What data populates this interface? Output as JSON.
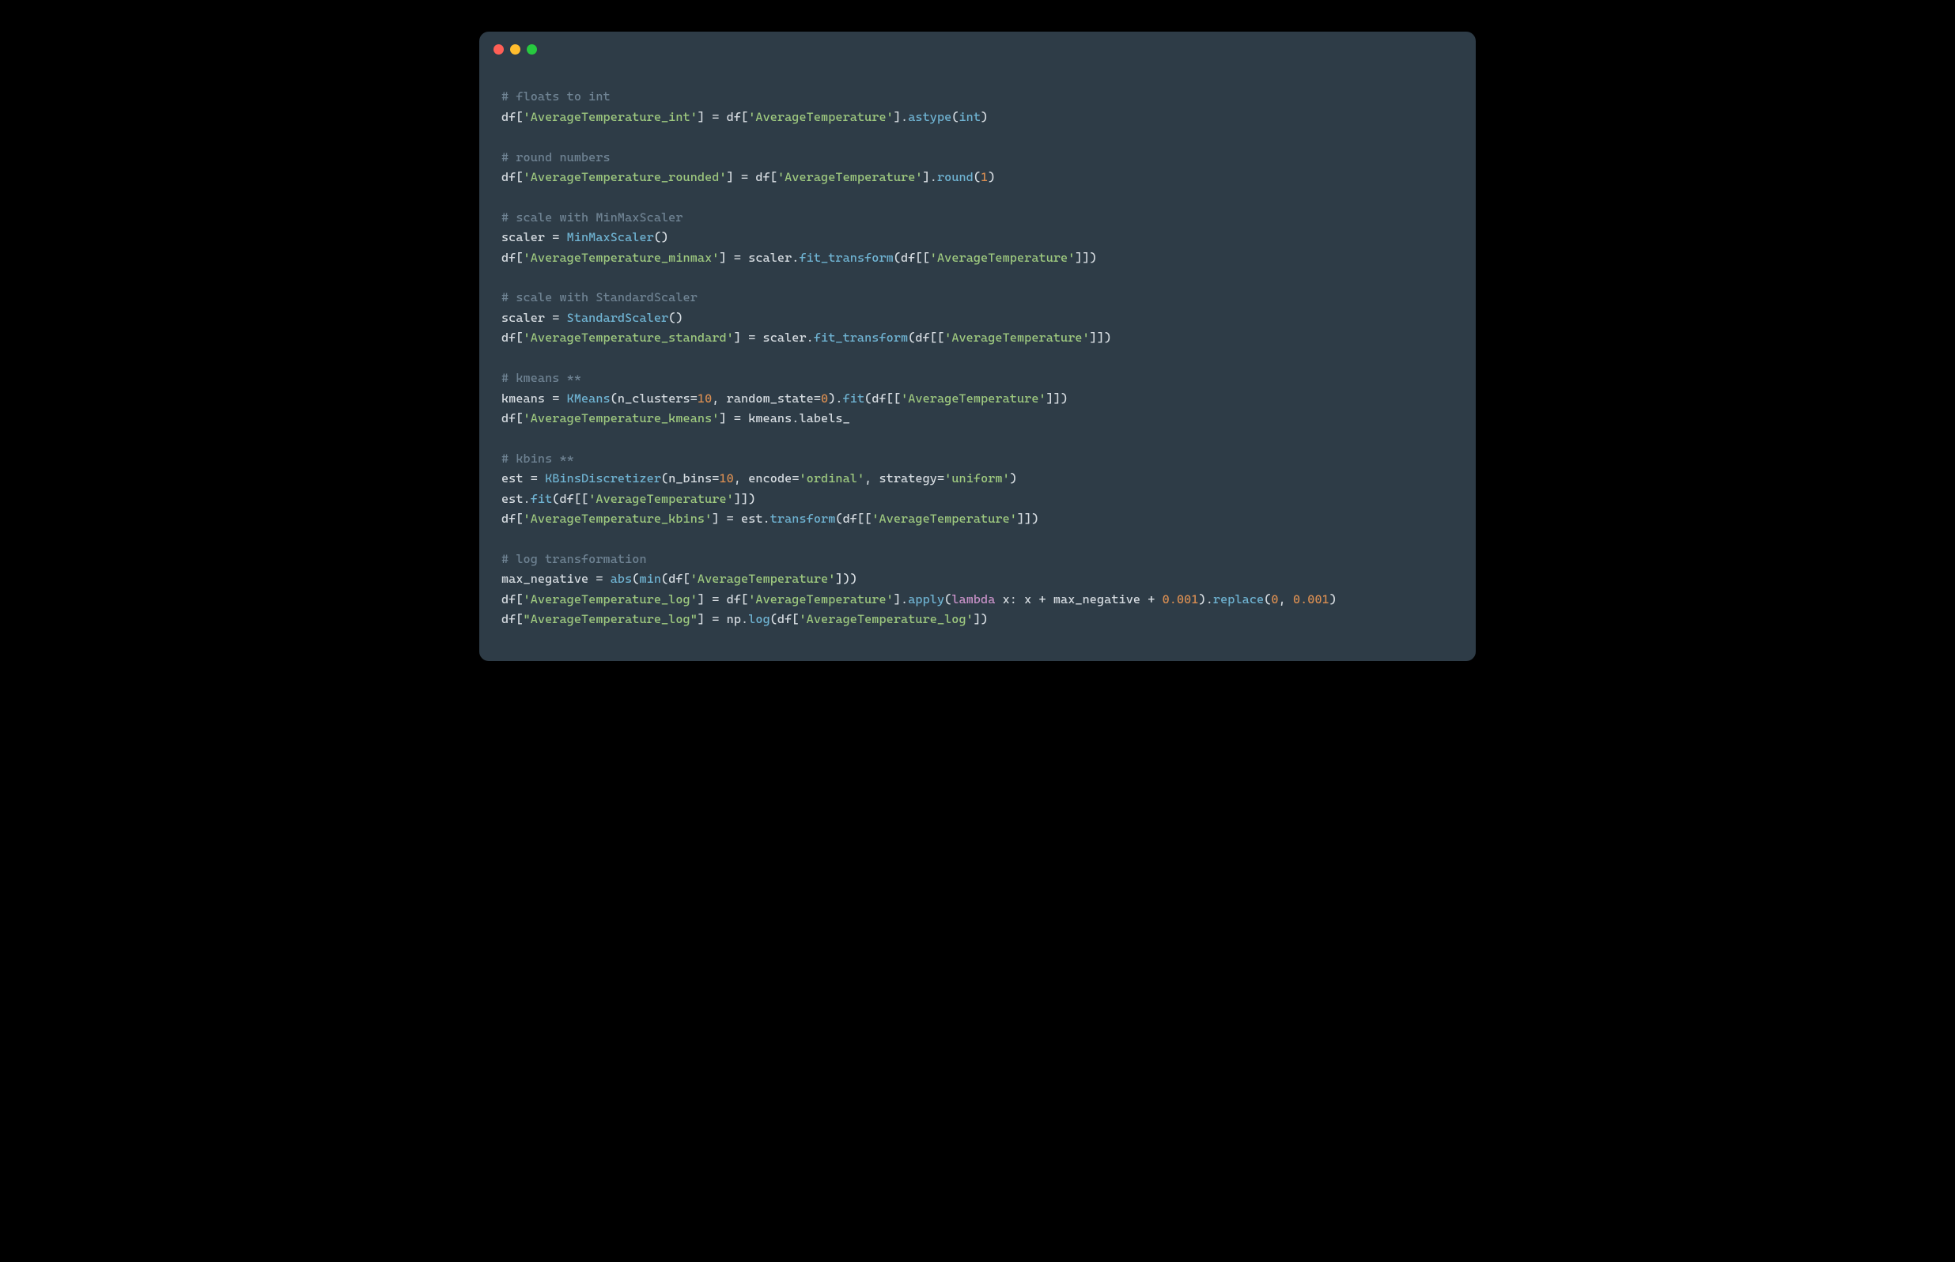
{
  "window": {
    "traffic_lights": [
      "red",
      "yellow",
      "green"
    ]
  },
  "code": {
    "blocks": [
      {
        "comment": "# floats to int",
        "lines": [
          [
            {
              "t": "id",
              "v": "df["
            },
            {
              "t": "str",
              "v": "'AverageTemperature_int'"
            },
            {
              "t": "id",
              "v": "] = df["
            },
            {
              "t": "str",
              "v": "'AverageTemperature'"
            },
            {
              "t": "id",
              "v": "]."
            },
            {
              "t": "fn",
              "v": "astype"
            },
            {
              "t": "id",
              "v": "("
            },
            {
              "t": "fn",
              "v": "int"
            },
            {
              "t": "id",
              "v": ")"
            }
          ]
        ]
      },
      {
        "comment": "# round numbers",
        "lines": [
          [
            {
              "t": "id",
              "v": "df["
            },
            {
              "t": "str",
              "v": "'AverageTemperature_rounded'"
            },
            {
              "t": "id",
              "v": "] = df["
            },
            {
              "t": "str",
              "v": "'AverageTemperature'"
            },
            {
              "t": "id",
              "v": "]."
            },
            {
              "t": "fn",
              "v": "round"
            },
            {
              "t": "id",
              "v": "("
            },
            {
              "t": "num",
              "v": "1"
            },
            {
              "t": "id",
              "v": ")"
            }
          ]
        ]
      },
      {
        "comment": "# scale with MinMaxScaler",
        "lines": [
          [
            {
              "t": "id",
              "v": "scaler = "
            },
            {
              "t": "fn",
              "v": "MinMaxScaler"
            },
            {
              "t": "id",
              "v": "()"
            }
          ],
          [
            {
              "t": "id",
              "v": "df["
            },
            {
              "t": "str",
              "v": "'AverageTemperature_minmax'"
            },
            {
              "t": "id",
              "v": "] = scaler."
            },
            {
              "t": "fn",
              "v": "fit_transform"
            },
            {
              "t": "id",
              "v": "(df[["
            },
            {
              "t": "str",
              "v": "'AverageTemperature'"
            },
            {
              "t": "id",
              "v": "]])"
            }
          ]
        ]
      },
      {
        "comment": "# scale with StandardScaler",
        "lines": [
          [
            {
              "t": "id",
              "v": "scaler = "
            },
            {
              "t": "fn",
              "v": "StandardScaler"
            },
            {
              "t": "id",
              "v": "()"
            }
          ],
          [
            {
              "t": "id",
              "v": "df["
            },
            {
              "t": "str",
              "v": "'AverageTemperature_standard'"
            },
            {
              "t": "id",
              "v": "] = scaler."
            },
            {
              "t": "fn",
              "v": "fit_transform"
            },
            {
              "t": "id",
              "v": "(df[["
            },
            {
              "t": "str",
              "v": "'AverageTemperature'"
            },
            {
              "t": "id",
              "v": "]])"
            }
          ]
        ]
      },
      {
        "comment": "# kmeans **",
        "lines": [
          [
            {
              "t": "id",
              "v": "kmeans = "
            },
            {
              "t": "fn",
              "v": "KMeans"
            },
            {
              "t": "id",
              "v": "(n_clusters="
            },
            {
              "t": "num",
              "v": "10"
            },
            {
              "t": "id",
              "v": ", random_state="
            },
            {
              "t": "num",
              "v": "0"
            },
            {
              "t": "id",
              "v": ")."
            },
            {
              "t": "fn",
              "v": "fit"
            },
            {
              "t": "id",
              "v": "(df[["
            },
            {
              "t": "str",
              "v": "'AverageTemperature'"
            },
            {
              "t": "id",
              "v": "]])"
            }
          ],
          [
            {
              "t": "id",
              "v": "df["
            },
            {
              "t": "str",
              "v": "'AverageTemperature_kmeans'"
            },
            {
              "t": "id",
              "v": "] = kmeans.labels_"
            }
          ]
        ]
      },
      {
        "comment": "# kbins **",
        "lines": [
          [
            {
              "t": "id",
              "v": "est = "
            },
            {
              "t": "fn",
              "v": "KBinsDiscretizer"
            },
            {
              "t": "id",
              "v": "(n_bins="
            },
            {
              "t": "num",
              "v": "10"
            },
            {
              "t": "id",
              "v": ", encode="
            },
            {
              "t": "str",
              "v": "'ordinal'"
            },
            {
              "t": "id",
              "v": ", strategy="
            },
            {
              "t": "str",
              "v": "'uniform'"
            },
            {
              "t": "id",
              "v": ")"
            }
          ],
          [
            {
              "t": "id",
              "v": "est."
            },
            {
              "t": "fn",
              "v": "fit"
            },
            {
              "t": "id",
              "v": "(df[["
            },
            {
              "t": "str",
              "v": "'AverageTemperature'"
            },
            {
              "t": "id",
              "v": "]])"
            }
          ],
          [
            {
              "t": "id",
              "v": "df["
            },
            {
              "t": "str",
              "v": "'AverageTemperature_kbins'"
            },
            {
              "t": "id",
              "v": "] = est."
            },
            {
              "t": "fn",
              "v": "transform"
            },
            {
              "t": "id",
              "v": "(df[["
            },
            {
              "t": "str",
              "v": "'AverageTemperature'"
            },
            {
              "t": "id",
              "v": "]])"
            }
          ]
        ]
      },
      {
        "comment": "# log transformation",
        "lines": [
          [
            {
              "t": "id",
              "v": "max_negative = "
            },
            {
              "t": "fn",
              "v": "abs"
            },
            {
              "t": "id",
              "v": "("
            },
            {
              "t": "fn",
              "v": "min"
            },
            {
              "t": "id",
              "v": "(df["
            },
            {
              "t": "str",
              "v": "'AverageTemperature'"
            },
            {
              "t": "id",
              "v": "]))"
            }
          ],
          [
            {
              "t": "id",
              "v": "df["
            },
            {
              "t": "str",
              "v": "'AverageTemperature_log'"
            },
            {
              "t": "id",
              "v": "] = df["
            },
            {
              "t": "str",
              "v": "'AverageTemperature'"
            },
            {
              "t": "id",
              "v": "]."
            },
            {
              "t": "fn",
              "v": "apply"
            },
            {
              "t": "id",
              "v": "("
            },
            {
              "t": "kw",
              "v": "lambda"
            },
            {
              "t": "id",
              "v": " x: x + max_negative + "
            },
            {
              "t": "num",
              "v": "0.001"
            },
            {
              "t": "id",
              "v": ")."
            },
            {
              "t": "fn",
              "v": "replace"
            },
            {
              "t": "id",
              "v": "("
            },
            {
              "t": "num",
              "v": "0"
            },
            {
              "t": "id",
              "v": ", "
            },
            {
              "t": "num",
              "v": "0.001"
            },
            {
              "t": "id",
              "v": ")"
            }
          ],
          [
            {
              "t": "id",
              "v": "df["
            },
            {
              "t": "str",
              "v": "\"AverageTemperature_log\""
            },
            {
              "t": "id",
              "v": "] = np."
            },
            {
              "t": "fn",
              "v": "log"
            },
            {
              "t": "id",
              "v": "(df["
            },
            {
              "t": "str",
              "v": "'AverageTemperature_log'"
            },
            {
              "t": "id",
              "v": "])"
            }
          ]
        ]
      }
    ]
  }
}
